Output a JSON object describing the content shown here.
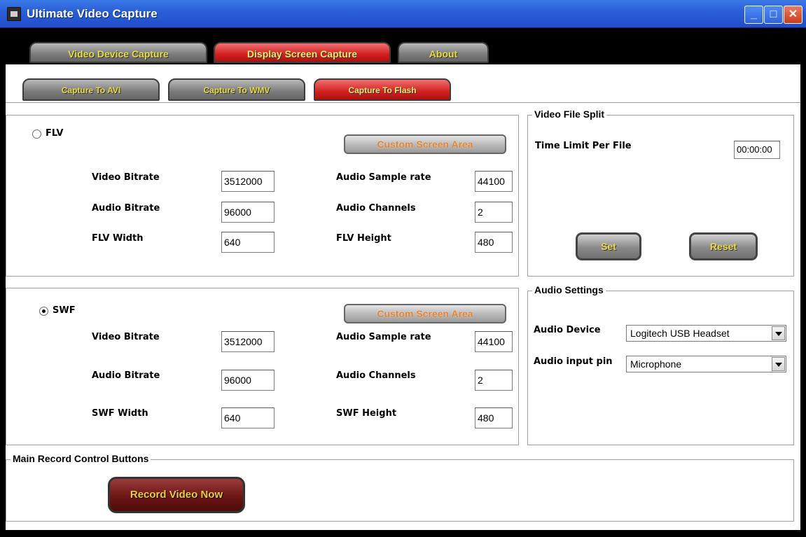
{
  "window": {
    "title": "Ultimate Video Capture"
  },
  "main_tabs": [
    {
      "label": "Video Device Capture",
      "selected": false
    },
    {
      "label": "Display Screen Capture",
      "selected": true
    },
    {
      "label": "About",
      "selected": false
    }
  ],
  "sub_tabs": [
    {
      "label": "Capture To AVI",
      "selected": false
    },
    {
      "label": "Capture To WMV",
      "selected": false
    },
    {
      "label": "Capture To Flash",
      "selected": true
    }
  ],
  "flv": {
    "radio_label": "FLV",
    "selected": false,
    "custom_area_label": "Custom Screen Area",
    "video_bitrate_label": "Video Bitrate",
    "video_bitrate": "3512000",
    "audio_bitrate_label": "Audio Bitrate",
    "audio_bitrate": "96000",
    "width_label": "FLV Width",
    "width": "640",
    "sample_rate_label": "Audio Sample rate",
    "sample_rate": "44100",
    "channels_label": "Audio Channels",
    "channels": "2",
    "height_label": "FLV Height",
    "height": "480"
  },
  "swf": {
    "radio_label": "SWF",
    "selected": true,
    "custom_area_label": "Custom Screen Area",
    "video_bitrate_label": "Video Bitrate",
    "video_bitrate": "3512000",
    "audio_bitrate_label": "Audio Bitrate",
    "audio_bitrate": "96000",
    "width_label": "SWF Width",
    "width": "640",
    "sample_rate_label": "Audio Sample rate",
    "sample_rate": "44100",
    "channels_label": "Audio Channels",
    "channels": "2",
    "height_label": "SWF Height",
    "height": "480"
  },
  "split": {
    "legend": "Video File Split",
    "time_limit_label": "Time Limit Per  File",
    "time_limit": "00:00:00",
    "set_label": "Set",
    "reset_label": "Reset"
  },
  "audio": {
    "legend": "Audio Settings",
    "device_label": "Audio Device",
    "device_value": "Logitech USB Headset",
    "pin_label": "Audio input pin",
    "pin_value": "Microphone"
  },
  "record": {
    "legend": "Main Record Control Buttons",
    "button_label": "Record Video Now"
  }
}
